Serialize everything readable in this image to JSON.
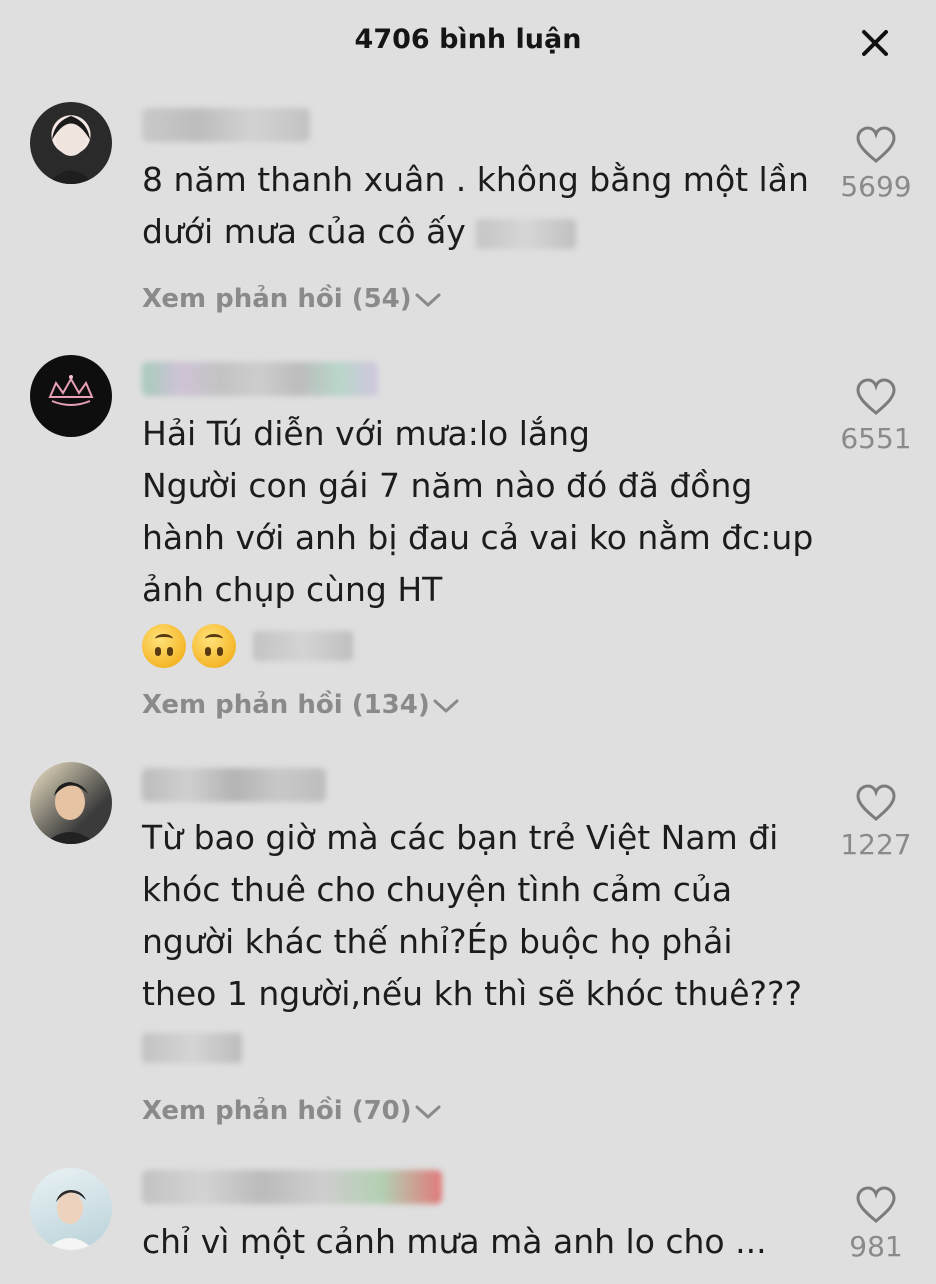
{
  "header": {
    "title": "4706 bình luận",
    "close_icon": "close-icon"
  },
  "comments": [
    {
      "text_lines": [
        "8 năm thanh xuân . không bằng một lần",
        "dưới mưa của cô ấy"
      ],
      "replies_label": "Xem phản hồi (54)",
      "likes": "5699"
    },
    {
      "text_lines": [
        "Hải Tú diễn với mưa:lo lắng",
        "Người con gái 7 năm nào đó đã đồng",
        "hành với anh bị đau cả vai ko nằm đc:up",
        "ảnh chụp cùng HT"
      ],
      "replies_label": "Xem phản hồi (134)",
      "likes": "6551"
    },
    {
      "text_lines": [
        "Từ bao giờ mà các bạn trẻ Việt Nam đi",
        "khóc thuê cho chuyện tình cảm của",
        "người khác thế nhỉ?Ép buộc họ phải",
        "theo 1 người,nếu kh thì sẽ khóc thuê???"
      ],
      "replies_label": "Xem phản hồi (70)",
      "likes": "1227"
    },
    {
      "text_lines": [
        "chỉ vì một cảnh mưa mà anh lo cho ..."
      ],
      "likes": "981"
    }
  ],
  "colors": {
    "background": "#dfdfdf",
    "muted_text": "#8a8a8a"
  }
}
